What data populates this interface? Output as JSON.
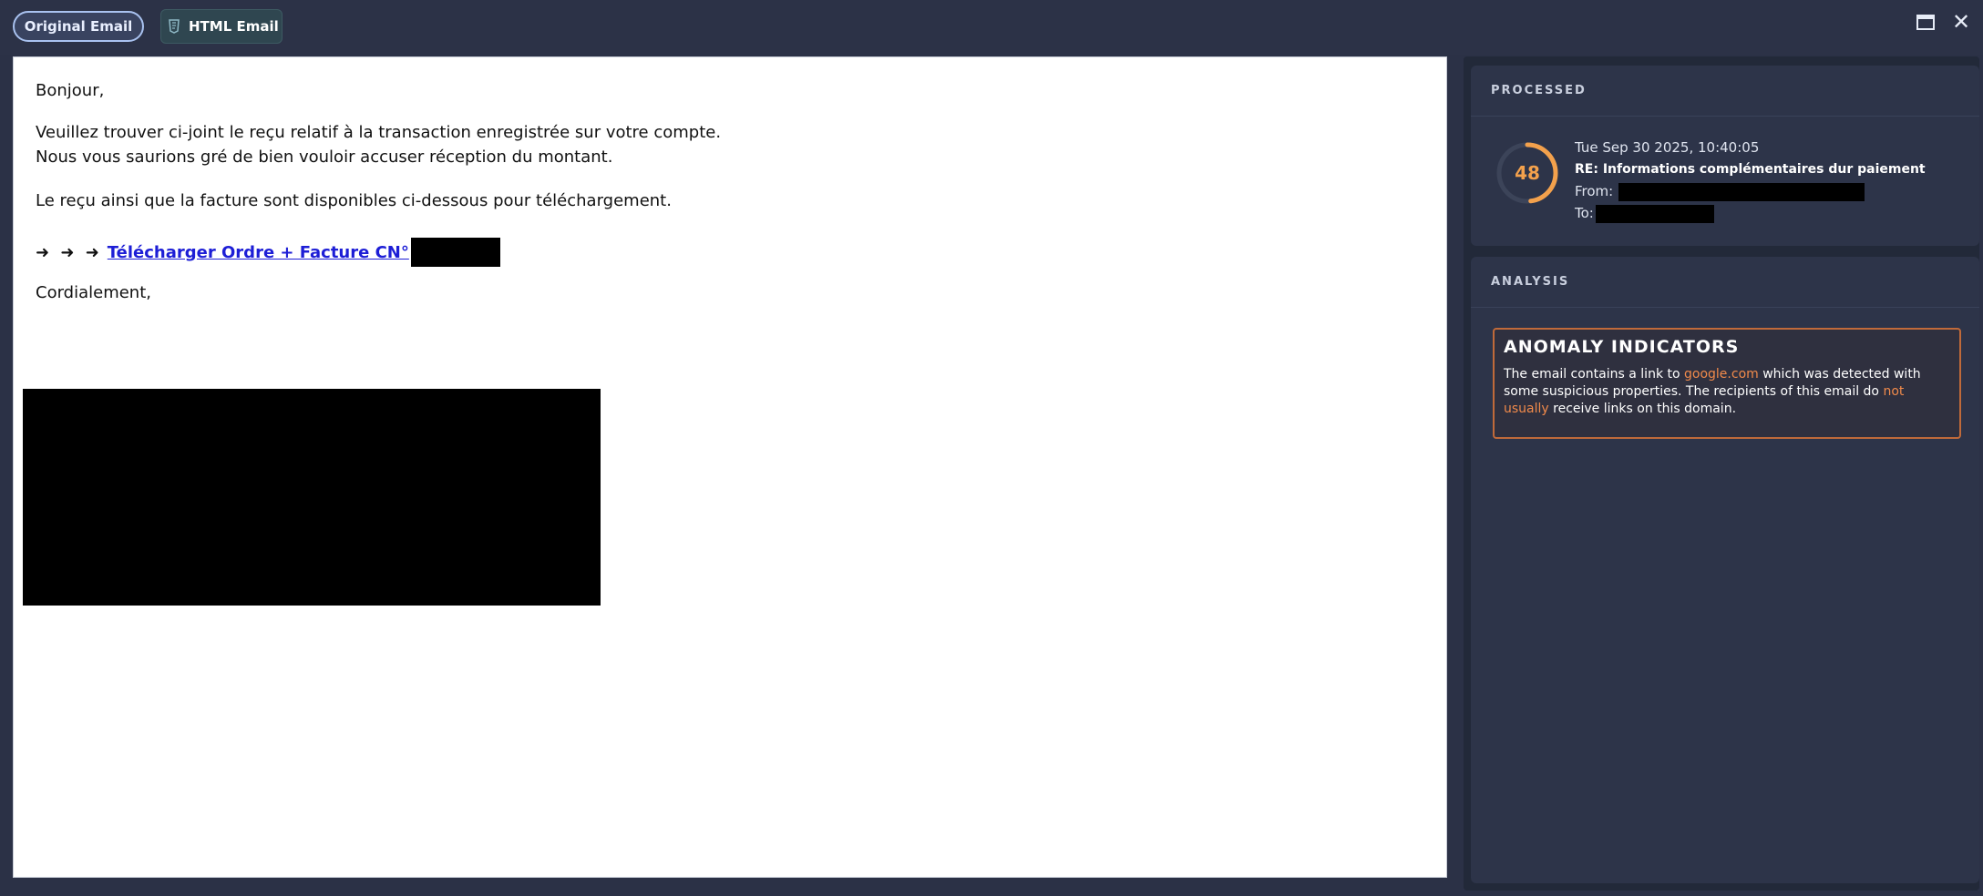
{
  "tabs": {
    "original_label": "Original Email",
    "html_label": "HTML Email"
  },
  "email": {
    "greeting": "Bonjour,",
    "line1": "Veuillez trouver ci-joint le reçu relatif à la transaction enregistrée sur votre compte.",
    "line2": "Nous vous saurions gré de bien vouloir accuser réception du montant.",
    "line3": "Le reçu ainsi que la facture sont disponibles ci-dessous pour téléchargement.",
    "arrows": "➜ ➜ ➜",
    "link_text": "Télécharger Ordre + Facture CN°",
    "closing": "Cordialement,"
  },
  "processed": {
    "heading": "PROCESSED",
    "score": "48",
    "score_fraction": 0.48,
    "timestamp": "Tue Sep 30 2025, 10:40:05",
    "subject": "RE: Informations complémentaires dur paiement",
    "from_label": "From:",
    "to_label": "To:"
  },
  "analysis": {
    "heading": "ANALYSIS",
    "anomaly_title": "ANOMALY INDICATORS",
    "text_1": "The email contains a link to ",
    "domain": "google.com",
    "text_2": " which was detected with some suspicious properties. The recipients of this email do ",
    "not_usually": "not usually",
    "text_3": " receive links on this domain."
  },
  "colors": {
    "accent_orange": "#f3a14c",
    "link_blue": "#1d1ed6",
    "anomaly_border": "#c06a3a"
  }
}
